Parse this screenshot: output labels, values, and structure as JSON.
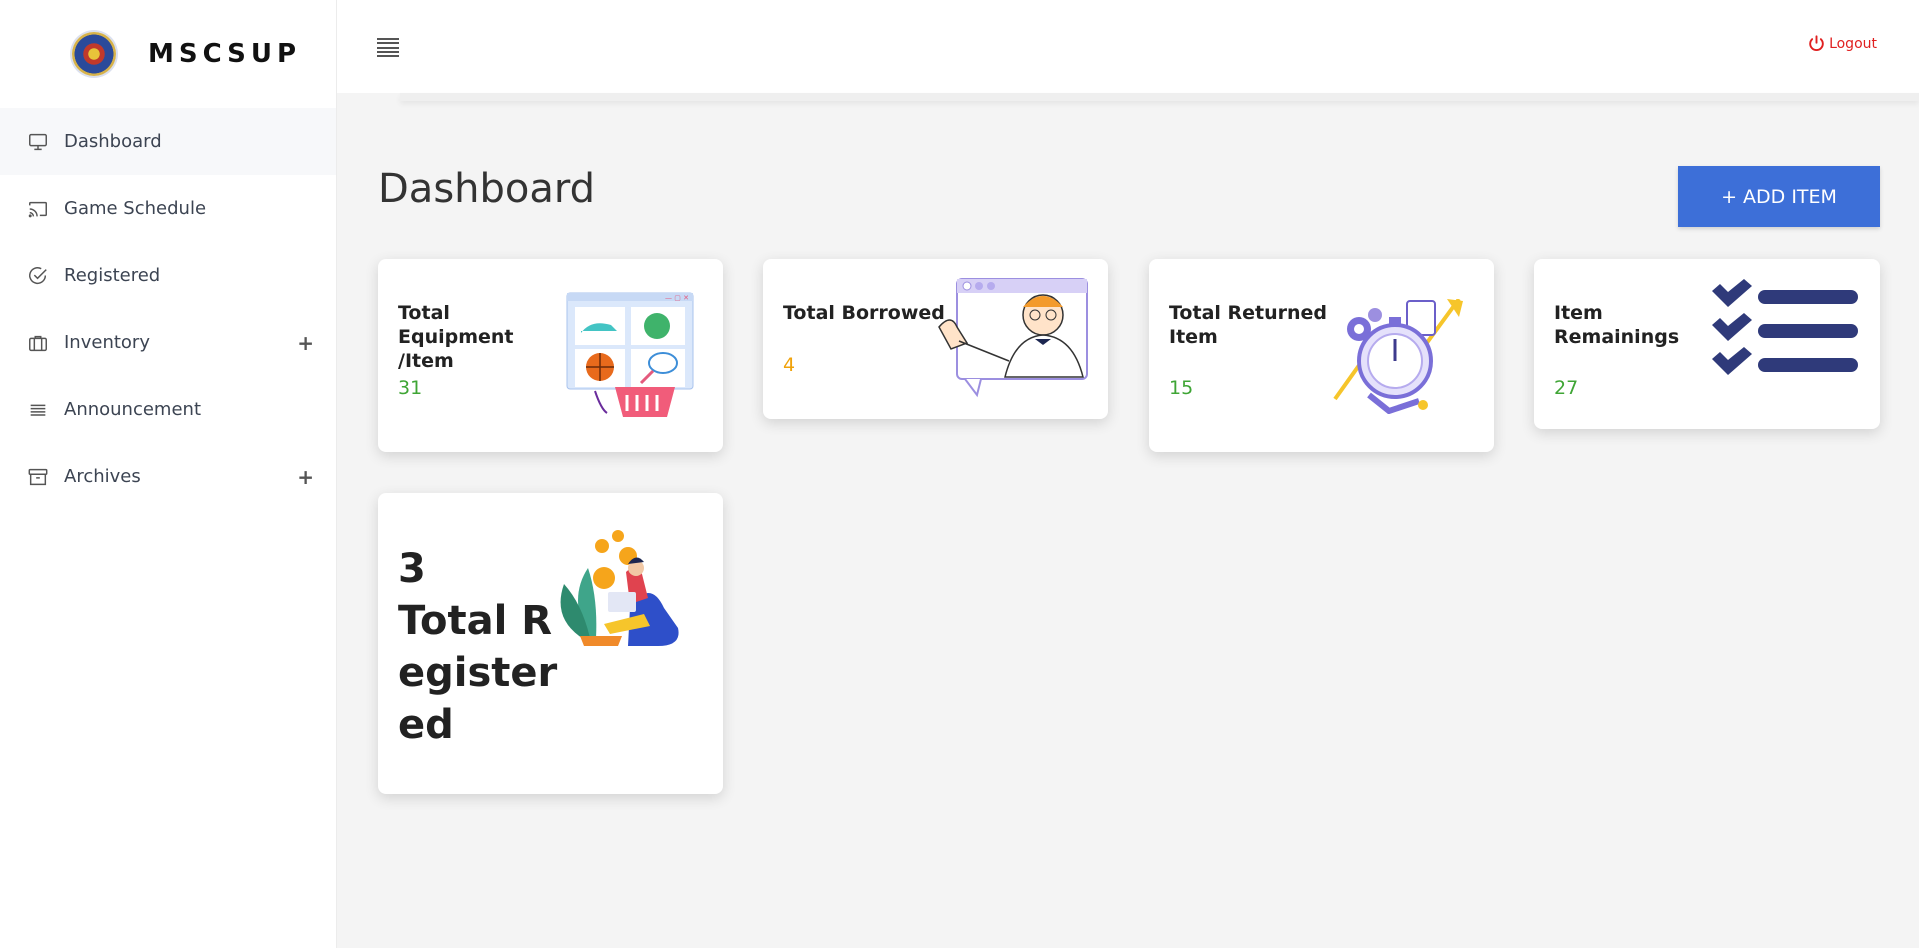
{
  "brand": {
    "name": "MSCSUP"
  },
  "sidebar": {
    "items": [
      {
        "label": "Dashboard",
        "icon": "monitor-icon",
        "active": true
      },
      {
        "label": "Game Schedule",
        "icon": "cast-icon"
      },
      {
        "label": "Registered",
        "icon": "check-circle-icon"
      },
      {
        "label": "Inventory",
        "icon": "briefcase-icon",
        "expand": "+"
      },
      {
        "label": "Announcement",
        "icon": "list-lines-icon"
      },
      {
        "label": "Archives",
        "icon": "archive-box-icon",
        "expand": "+"
      }
    ]
  },
  "topbar": {
    "logout_label": "Logout"
  },
  "main": {
    "title": "Dashboard",
    "add_button_label": "+ ADD ITEM",
    "cards": [
      {
        "label": "Total Equipment /Item",
        "value": "31",
        "value_color": "#3fa535"
      },
      {
        "label": "Total Borrowed",
        "value": "4",
        "value_color": "#f0a20a"
      },
      {
        "label": "Total Returned Item",
        "value": "15",
        "value_color": "#3fa535"
      },
      {
        "label": "Item Remainings",
        "value": "27",
        "value_color": "#3fa535"
      },
      {
        "value": "3",
        "label": "Total Registered"
      }
    ]
  },
  "colors": {
    "accent": "#3d6fd8",
    "logout": "#e02020",
    "checks": "#2f3a7a"
  }
}
